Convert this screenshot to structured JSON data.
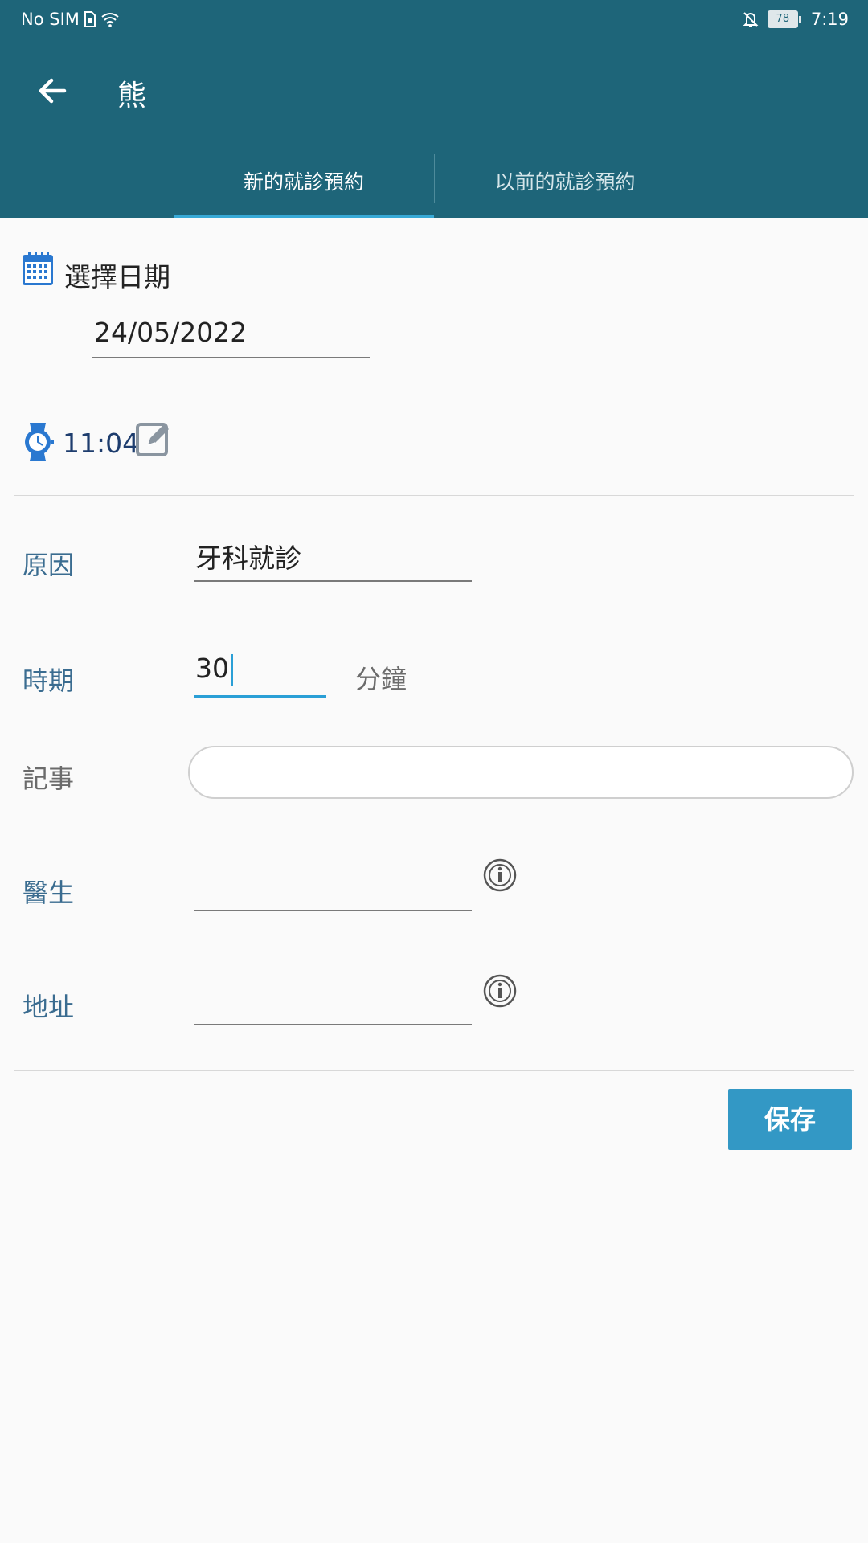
{
  "status_bar": {
    "carrier": "No SIM",
    "battery": "78",
    "time": "7:19"
  },
  "app_bar": {
    "title": "熊"
  },
  "tabs": [
    {
      "label": "新的就診預約",
      "active": true
    },
    {
      "label": "以前的就診預約",
      "active": false
    }
  ],
  "date_section": {
    "label": "選擇日期",
    "value": "24/05/2022"
  },
  "time_section": {
    "value": "11:04"
  },
  "form": {
    "reason": {
      "label": "原因",
      "value": "牙科就診"
    },
    "duration": {
      "label": "時期",
      "value": "30",
      "unit": "分鐘"
    },
    "notes": {
      "label": "記事",
      "value": ""
    },
    "doctor": {
      "label": "醫生",
      "value": ""
    },
    "address": {
      "label": "地址",
      "value": ""
    }
  },
  "actions": {
    "save_label": "保存"
  },
  "colors": {
    "header": "#1e6579",
    "accent": "#37a9d6",
    "button": "#3398c5",
    "label": "#3a6c90"
  }
}
